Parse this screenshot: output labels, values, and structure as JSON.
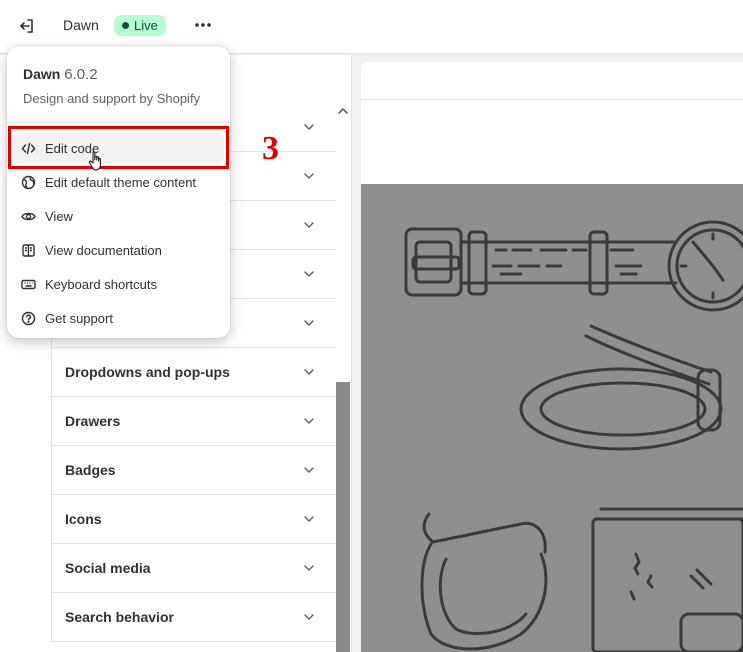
{
  "topbar": {
    "exit_icon": "exit-icon",
    "theme_name": "Dawn",
    "status_badge": "Live",
    "more_icon": "more-horizontal-icon"
  },
  "popover": {
    "theme_name": "Dawn",
    "version": "6.0.2",
    "subtitle": "Design and support by Shopify",
    "items": [
      {
        "label": "Edit code",
        "icon": "code-icon"
      },
      {
        "label": "Edit default theme content",
        "icon": "globe-icon"
      },
      {
        "label": "View",
        "icon": "eye-icon"
      },
      {
        "label": "View documentation",
        "icon": "book-icon"
      },
      {
        "label": "Keyboard shortcuts",
        "icon": "keyboard-icon"
      },
      {
        "label": "Get support",
        "icon": "question-circle-icon"
      }
    ]
  },
  "annotation": {
    "step_number": "3"
  },
  "settings": {
    "items": [
      {
        "label": ""
      },
      {
        "label": ""
      },
      {
        "label": ""
      },
      {
        "label": ""
      },
      {
        "label": ""
      },
      {
        "label": "Dropdowns and pop-ups"
      },
      {
        "label": "Drawers"
      },
      {
        "label": "Badges"
      },
      {
        "label": "Icons"
      },
      {
        "label": "Social media"
      },
      {
        "label": "Search behavior"
      }
    ]
  },
  "colors": {
    "highlight": "#e00000",
    "live_badge_bg": "#b4fed2",
    "live_badge_text": "#0c5132"
  }
}
